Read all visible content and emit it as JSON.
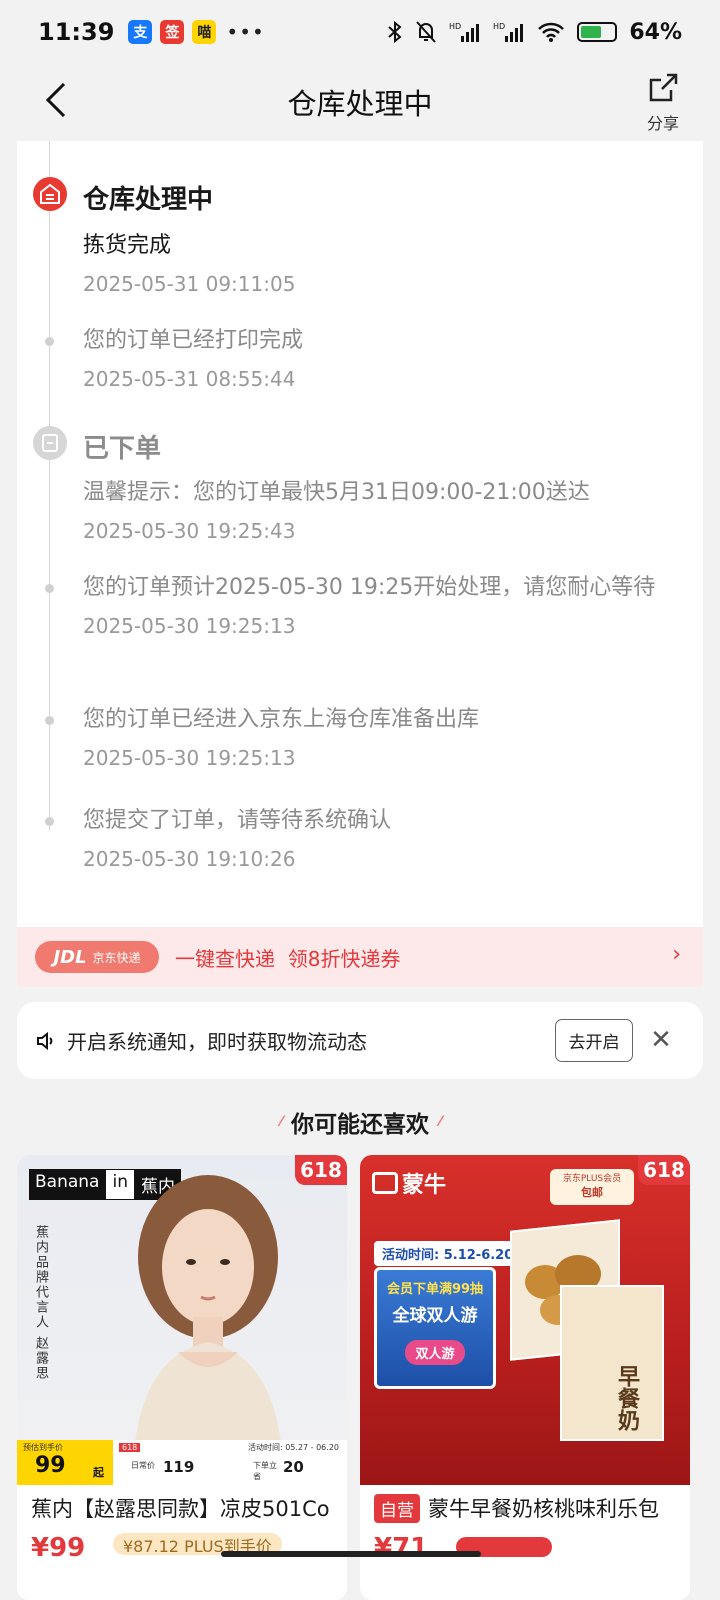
{
  "status_bar": {
    "time": "11:39",
    "apps": [
      "支",
      "签",
      "喵"
    ],
    "more": "•••",
    "battery_level": 64,
    "battery_label": "64%",
    "network": [
      "HD",
      "HD"
    ]
  },
  "nav": {
    "title": "仓库处理中",
    "share_label": "分享"
  },
  "timeline": {
    "group1": {
      "status": "仓库处理中",
      "events": [
        {
          "text": "拣货完成",
          "time": "2025-05-31 09:11:05"
        },
        {
          "text": "您的订单已经打印完成",
          "time": "2025-05-31 08:55:44"
        }
      ]
    },
    "group2": {
      "status": "已下单",
      "events": [
        {
          "text": "温馨提示：您的订单最快5月31日09:00-21:00送达",
          "time": "2025-05-30 19:25:43"
        },
        {
          "text": "您的订单预计2025-05-30 19:25开始处理，请您耐心等待",
          "time": "2025-05-30 19:25:13"
        },
        {
          "text": "您的订单已经进入京东上海仓库准备出库",
          "time": "2025-05-30 19:25:13"
        },
        {
          "text": "您提交了订单，请等待系统确认",
          "time": "2025-05-30 19:10:26"
        }
      ]
    }
  },
  "jdl_banner": {
    "logo_mark": "JDL",
    "logo_text": "京东快递",
    "text": "一键查快递  领8折快递券",
    "chevron": "›"
  },
  "notify": {
    "text": "开启系统通知，即时获取物流动态",
    "button": "去开启",
    "close": "✕"
  },
  "recommend": {
    "title": "你可能还喜欢",
    "products": [
      {
        "badge": "618",
        "brand_tag": [
          "Banana",
          "in",
          "蕉内"
        ],
        "vertical_text": "蕉内品牌代言人 赵露思",
        "strip_label": "预估到手价",
        "strip_price": "99",
        "strip_qi": "起",
        "strip_618": "618",
        "strip_activity": "活动时间: 05.27 - 06.20",
        "strip_daily_label": "日常价",
        "strip_daily_value": "119",
        "strip_order_label": "下单立省",
        "strip_order_value": "20",
        "name": "蕉内【赵露思同款】凉皮501Co",
        "price_peek": "¥99",
        "tag_peek": "¥87.12 PLUS到手价"
      },
      {
        "badge": "618",
        "logo": "蒙牛",
        "plus_tag_l1": "京东PLUS会员",
        "plus_tag_l2": "包邮",
        "activity": "活动时间: 5.12-6.20",
        "promo_l1": "会员下单满99抽",
        "promo_l2": "全球双人游",
        "promo_l3": "双人游",
        "milk_label": "早餐奶",
        "ziying": "自营",
        "name": "蒙牛早餐奶核桃味利乐包",
        "price_peek": "¥71"
      }
    ]
  }
}
